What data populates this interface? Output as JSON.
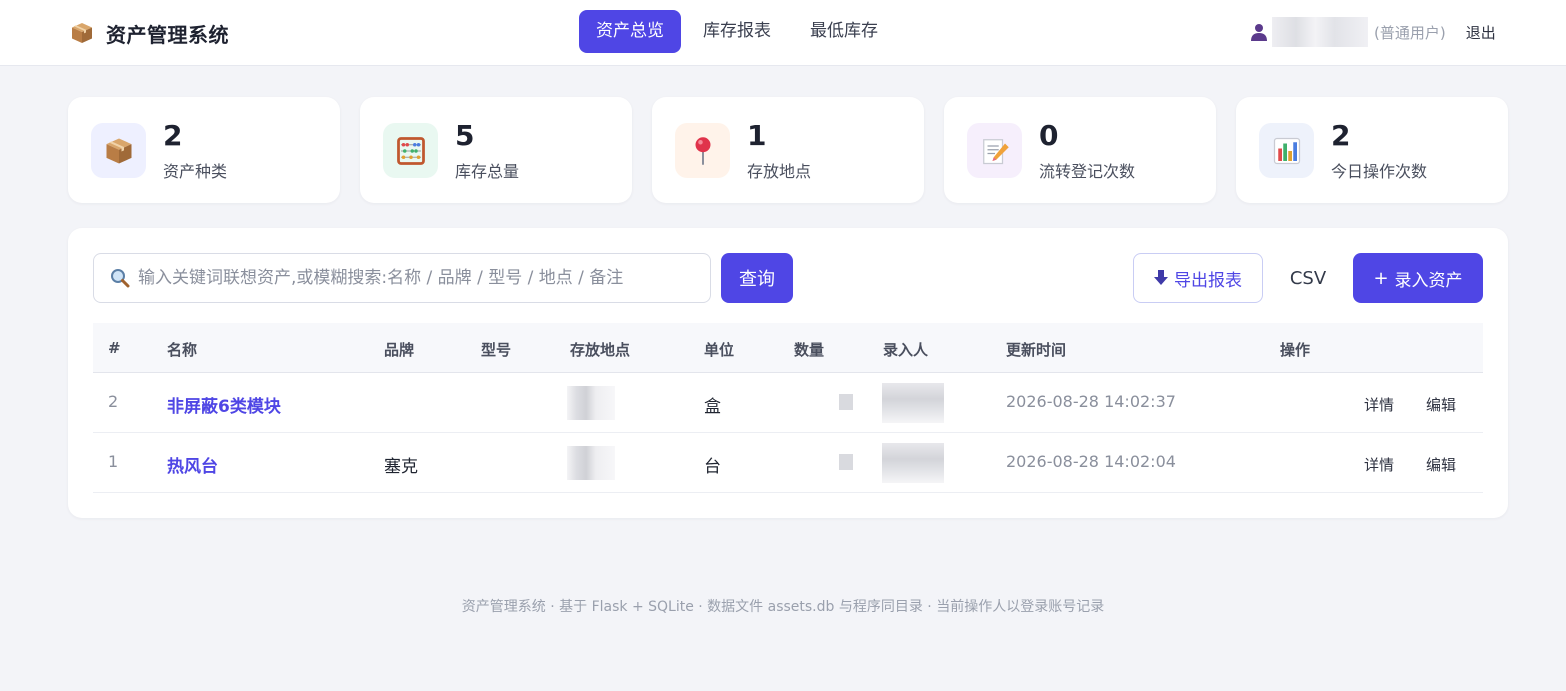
{
  "header": {
    "title": "资产管理系统",
    "tabs": [
      {
        "label": "资产总览",
        "active": true
      },
      {
        "label": "库存报表",
        "active": false
      },
      {
        "label": "最低库存",
        "active": false
      }
    ],
    "user_role": "(普通用户)",
    "logout": "退出"
  },
  "stats": [
    {
      "value": "2",
      "label": "资产种类",
      "icon": "package-icon",
      "bg": "#eef0ff"
    },
    {
      "value": "5",
      "label": "库存总量",
      "icon": "abacus-icon",
      "bg": "#e9f8f1"
    },
    {
      "value": "1",
      "label": "存放地点",
      "icon": "pushpin-icon",
      "bg": "#fff3ea"
    },
    {
      "value": "0",
      "label": "流转登记次数",
      "icon": "memo-icon",
      "bg": "#f6effc"
    },
    {
      "value": "2",
      "label": "今日操作次数",
      "icon": "bar-chart-icon",
      "bg": "#eef2fb"
    }
  ],
  "toolbar": {
    "search_placeholder": "输入关键词联想资产,或模糊搜索:名称 / 品牌 / 型号 / 地点 / 备注",
    "query": "查询",
    "export": "导出报表",
    "csv": "CSV",
    "add": "录入资产"
  },
  "table": {
    "columns": [
      "#",
      "名称",
      "品牌",
      "型号",
      "存放地点",
      "单位",
      "数量",
      "录入人",
      "更新时间",
      "操作"
    ],
    "rows": [
      {
        "idx": "2",
        "name": "非屏蔽6类模块",
        "brand": "",
        "model": "",
        "unit": "盒",
        "updated": "2026-08-28 14:02:37"
      },
      {
        "idx": "1",
        "name": "热风台",
        "brand": "塞克",
        "model": "",
        "unit": "台",
        "updated": "2026-08-28 14:02:04"
      }
    ],
    "action_detail": "详情",
    "action_edit": "编辑"
  },
  "footer": "资产管理系统 · 基于 Flask + SQLite · 数据文件 assets.db 与程序同目录 · 当前操作人以登录账号记录",
  "colors": {
    "accent": "#4f46e5",
    "background": "#f3f4f8"
  }
}
